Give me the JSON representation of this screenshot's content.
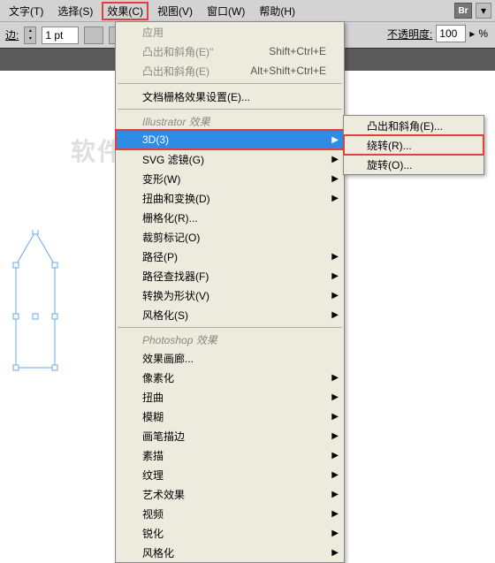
{
  "menubar": {
    "items": [
      "文字(T)",
      "选择(S)",
      "效果(C)",
      "视图(V)",
      "窗口(W)",
      "帮助(H)"
    ],
    "highlighted_index": 2,
    "br_icon": "Br"
  },
  "toolbar": {
    "stroke_label": "边:",
    "stroke_value": "1 pt",
    "opacity_label": "不透明度:",
    "opacity_value": "100",
    "opacity_unit": "%"
  },
  "watermark_text": "软件自学网",
  "menu": {
    "top": [
      {
        "label": "应用",
        "shortcut": "",
        "enabled": false
      },
      {
        "label": "凸出和斜角(E)\"",
        "shortcut": "Shift+Ctrl+E",
        "enabled": false
      },
      {
        "label": "凸出和斜角(E)",
        "shortcut": "Alt+Shift+Ctrl+E",
        "enabled": false
      }
    ],
    "doc_grid": "文档栅格效果设置(E)...",
    "header1": "Illustrator 效果",
    "ai_effects": [
      {
        "label": "3D(3)",
        "selected": true,
        "boxed": true
      },
      {
        "label": "SVG 滤镜(G)"
      },
      {
        "label": "变形(W)"
      },
      {
        "label": "扭曲和变换(D)"
      },
      {
        "label": "栅格化(R)..."
      },
      {
        "label": "裁剪标记(O)"
      },
      {
        "label": "路径(P)"
      },
      {
        "label": "路径查找器(F)"
      },
      {
        "label": "转换为形状(V)"
      },
      {
        "label": "风格化(S)"
      }
    ],
    "header2": "Photoshop 效果",
    "ps_effects": [
      "效果画廊...",
      "像素化",
      "扭曲",
      "模糊",
      "画笔描边",
      "素描",
      "纹理",
      "艺术效果",
      "视频",
      "锐化",
      "风格化"
    ]
  },
  "submenu": {
    "items": [
      {
        "label": "凸出和斜角(E)..."
      },
      {
        "label": "绕转(R)...",
        "boxed": true
      },
      {
        "label": "旋转(O)..."
      }
    ]
  }
}
